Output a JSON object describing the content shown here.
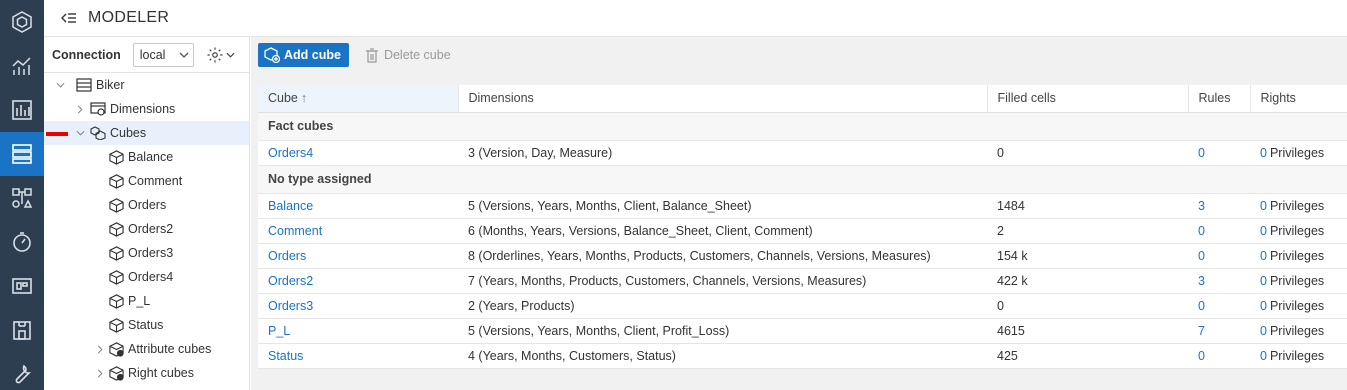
{
  "header": {
    "title": "MODELER"
  },
  "connection": {
    "label": "Connection",
    "value": "local"
  },
  "rail": {
    "items": [
      {
        "name": "logo-icon"
      },
      {
        "name": "analytics-icon"
      },
      {
        "name": "reports-icon"
      },
      {
        "name": "modeler-icon",
        "active": true
      },
      {
        "name": "etl-icon"
      },
      {
        "name": "scheduler-icon"
      },
      {
        "name": "designer-icon"
      },
      {
        "name": "store-icon"
      },
      {
        "name": "tools-icon"
      }
    ]
  },
  "tree": {
    "root": "Biker",
    "dimensions": "Dimensions",
    "cubes": "Cubes",
    "cube_items": [
      "Balance",
      "Comment",
      "Orders",
      "Orders2",
      "Orders3",
      "Orders4",
      "P_L",
      "Status"
    ],
    "attribute_cubes": "Attribute cubes",
    "right_cubes": "Right cubes"
  },
  "toolbar": {
    "add_label": "Add cube",
    "delete_label": "Delete cube"
  },
  "table": {
    "columns": {
      "cube": "Cube",
      "dimensions": "Dimensions",
      "filled": "Filled cells",
      "rules": "Rules",
      "rights": "Rights"
    },
    "groups": [
      {
        "label": "Fact cubes",
        "rows": [
          {
            "cube": "Orders4",
            "dimensions": "3 (Version, Day, Measure)",
            "filled": "0",
            "rules": "0",
            "rights_num": "0",
            "rights_text": "Privileges"
          }
        ]
      },
      {
        "label": "No type assigned",
        "rows": [
          {
            "cube": "Balance",
            "dimensions": "5 (Versions, Years, Months, Client, Balance_Sheet)",
            "filled": "1484",
            "rules": "3",
            "rights_num": "0",
            "rights_text": "Privileges"
          },
          {
            "cube": "Comment",
            "dimensions": "6 (Months, Years, Versions, Balance_Sheet, Client, Comment)",
            "filled": "2",
            "rules": "0",
            "rights_num": "0",
            "rights_text": "Privileges"
          },
          {
            "cube": "Orders",
            "dimensions": "8 (Orderlines, Years, Months, Products, Customers, Channels, Versions, Measures)",
            "filled": "154 k",
            "rules": "0",
            "rights_num": "0",
            "rights_text": "Privileges"
          },
          {
            "cube": "Orders2",
            "dimensions": "7 (Years, Months, Products, Customers, Channels, Versions, Measures)",
            "filled": "422 k",
            "rules": "3",
            "rights_num": "0",
            "rights_text": "Privileges"
          },
          {
            "cube": "Orders3",
            "dimensions": "2 (Years, Products)",
            "filled": "0",
            "rules": "0",
            "rights_num": "0",
            "rights_text": "Privileges"
          },
          {
            "cube": "P_L",
            "dimensions": "5 (Versions, Years, Months, Client, Profit_Loss)",
            "filled": "4615",
            "rules": "7",
            "rights_num": "0",
            "rights_text": "Privileges"
          },
          {
            "cube": "Status",
            "dimensions": "4 (Years, Months, Customers, Status)",
            "filled": "425",
            "rules": "0",
            "rights_num": "0",
            "rights_text": "Privileges"
          }
        ]
      }
    ]
  },
  "colors": {
    "rail": "#2d3e50",
    "accent": "#1a74c6",
    "marker": "#e00000"
  }
}
